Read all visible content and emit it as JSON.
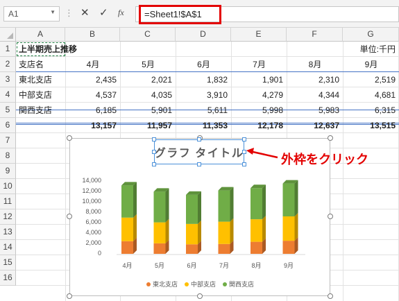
{
  "formula_bar": {
    "name_box": "A1",
    "cancel_icon": "✕",
    "enter_icon": "✓",
    "fx_label": "fx",
    "formula": "=Sheet1!$A$1"
  },
  "columns": [
    "A",
    "B",
    "C",
    "D",
    "E",
    "F",
    "G"
  ],
  "rows": [
    "1",
    "2",
    "3",
    "4",
    "5",
    "6",
    "7",
    "8",
    "9",
    "10",
    "11",
    "12",
    "13",
    "14",
    "15",
    "16"
  ],
  "sheet": {
    "title": "上半期売上推移",
    "unit": "単位:千円",
    "header": [
      "支店名",
      "4月",
      "5月",
      "6月",
      "7月",
      "8月",
      "9月"
    ],
    "data_rows": [
      [
        "東北支店",
        "2,435",
        "2,021",
        "1,832",
        "1,901",
        "2,310",
        "2,519"
      ],
      [
        "中部支店",
        "4,537",
        "4,035",
        "3,910",
        "4,279",
        "4,344",
        "4,681"
      ],
      [
        "関西支店",
        "6,185",
        "5,901",
        "5,611",
        "5,998",
        "5,983",
        "6,315"
      ]
    ],
    "totals": [
      "13,157",
      "11,957",
      "11,353",
      "12,178",
      "12,637",
      "13,515"
    ]
  },
  "callout": "外枠をクリック",
  "colors": {
    "tohoku": "#ed7d31",
    "chubu": "#ffc000",
    "kansai": "#70ad47",
    "callout": "#e30000",
    "selection": "#4a90d9"
  },
  "chart_data": {
    "type": "bar",
    "stacked": true,
    "three_d": true,
    "title": "グラフ タイトル",
    "categories": [
      "4月",
      "5月",
      "6月",
      "7月",
      "8月",
      "9月"
    ],
    "series": [
      {
        "name": "東北支店",
        "values": [
          2435,
          2021,
          1832,
          1901,
          2310,
          2519
        ]
      },
      {
        "name": "中部支店",
        "values": [
          4537,
          4035,
          3910,
          4279,
          4344,
          4681
        ]
      },
      {
        "name": "関西支店",
        "values": [
          6185,
          5901,
          5611,
          5998,
          5983,
          6315
        ]
      }
    ],
    "ylim": [
      0,
      14000
    ],
    "yticks": [
      "0",
      "2,000",
      "4,000",
      "6,000",
      "8,000",
      "10,000",
      "12,000",
      "14,000"
    ],
    "legend_position": "bottom",
    "grid": false
  }
}
